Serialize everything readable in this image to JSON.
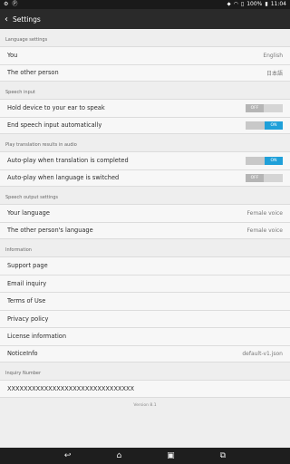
{
  "status_bar": {
    "left_icons": [
      "settings-icon",
      "circle-p-icon"
    ],
    "time": "11:04",
    "battery": "100%",
    "icons": [
      "location-icon",
      "wifi-icon",
      "no-sim-icon",
      "battery-icon"
    ]
  },
  "app_bar": {
    "title": "Settings"
  },
  "sections": {
    "language": {
      "header": "Language settings",
      "you_label": "You",
      "you_value": "English",
      "other_label": "The other person",
      "other_value": "日本語"
    },
    "speech_input": {
      "header": "Speech input",
      "hold_label": "Hold device to your ear to speak",
      "hold_toggle": "OFF",
      "end_label": "End speech input automatically",
      "end_toggle": "ON"
    },
    "playback": {
      "header": "Play translation results in audio",
      "auto_complete_label": "Auto-play when translation is completed",
      "auto_complete_toggle": "ON",
      "auto_switch_label": "Auto-play when language is switched",
      "auto_switch_toggle": "OFF"
    },
    "speech_output": {
      "header": "Speech output settings",
      "your_lang_label": "Your language",
      "your_lang_value": "Female voice",
      "other_lang_label": "The other person's language",
      "other_lang_value": "Female voice"
    },
    "information": {
      "header": "Information",
      "support": "Support page",
      "email": "Email inquiry",
      "terms": "Terms of Use",
      "privacy": "Privacy policy",
      "license": "License information",
      "notice_label": "NoticeInfo",
      "notice_value": "default-v1.json"
    },
    "inquiry": {
      "header": "Inquiry Number",
      "number": "XXXXXXXXXXXXXXXXXXXXXXXXXXXXXXX"
    }
  },
  "version": "Version 8.1",
  "nav_bar": {
    "back": "↩",
    "home": "⌂",
    "recents": "▣",
    "screenshot": "⧉"
  },
  "colors": {
    "accent": "#1fa0d9",
    "app_bar": "#2a2a2a",
    "background": "#eeeeee"
  }
}
